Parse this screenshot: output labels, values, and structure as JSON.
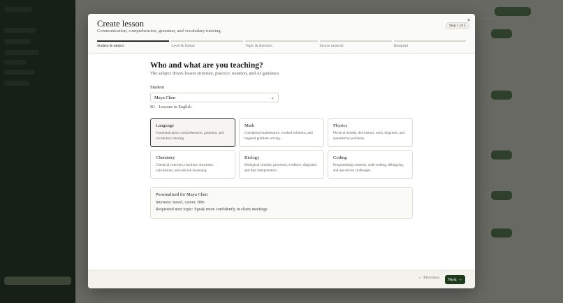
{
  "modal": {
    "title": "Create lesson",
    "subtitle": "Communication, comprehension, grammar, and vocabulary tutoring.",
    "step_badge": "Step 1 of 5",
    "close_icon": "×"
  },
  "steps": [
    {
      "label": "Student & subject",
      "active": true
    },
    {
      "label": "Level & format",
      "active": false
    },
    {
      "label": "Topic & direction",
      "active": false
    },
    {
      "label": "Source material",
      "active": false
    },
    {
      "label": "Blueprint",
      "active": false
    }
  ],
  "body": {
    "title": "Who and what are you teaching?",
    "description": "The subject drives lesson structure, practice, notation, and AI guidance.",
    "student_label": "Student",
    "student_value": "Maya Chen",
    "student_meta": "B1 · Lessons in English"
  },
  "subjects": [
    {
      "name": "Language",
      "description": "Communication, comprehension, grammar, and vocabulary tutoring.",
      "selected": true
    },
    {
      "name": "Math",
      "description": "Conceptual mathematics, worked solutions, and targeted problem solving.",
      "selected": false
    },
    {
      "name": "Physics",
      "description": "Physical models, derivations, units, diagrams, and quantitative problems.",
      "selected": false
    },
    {
      "name": "Chemistry",
      "description": "Chemical concepts, reactions, structures, calculations, and safe lab reasoning.",
      "selected": false
    },
    {
      "name": "Biology",
      "description": "Biological systems, processes, evidence, diagrams, and data interpretation.",
      "selected": false
    },
    {
      "name": "Coding",
      "description": "Programming concepts, code reading, debugging, and test-driven challenges.",
      "selected": false
    }
  ],
  "personalized": {
    "title": "Personalized for Maya Chen",
    "interests": "Interests: travel, career, film",
    "next_topic": "Requested next topic: Speak more confidently in client meetings"
  },
  "footer": {
    "previous_label": "Previous",
    "next_label": "Next",
    "previous_icon": "arrow-left-icon",
    "next_icon": "arrow-right-icon"
  },
  "colors": {
    "accent": "#1e3b1e",
    "selected_border": "#3a3a36"
  }
}
